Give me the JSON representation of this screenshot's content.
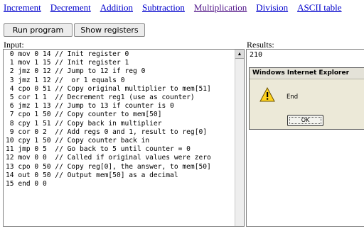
{
  "nav": {
    "links": [
      "Increment",
      "Decrement",
      "Addition",
      "Subtraction",
      "Multiplication",
      "Division",
      "ASCII table"
    ]
  },
  "buttons": {
    "run": "Run program",
    "show": "Show registers"
  },
  "input": {
    "label": "Input:",
    "lines": [
      " 0 mov 0 14 // Init register 0",
      " 1 mov 1 15 // Init register 1",
      " 2 jmz 0 12 // Jump to 12 if reg 0",
      " 3 jmz 1 12 //  or 1 equals 0",
      " 4 cpo 0 51 // Copy original multiplier to mem[51]",
      " 5 cor 1 1  // Decrement reg1 (use as counter)",
      " 6 jmz 1 13 // Jump to 13 if counter is 0",
      " 7 cpo 1 50 // Copy counter to mem[50]",
      " 8 cpy 1 51 // Copy back in multiplier",
      " 9 cor 0 2  // Add regs 0 and 1, result to reg[0]",
      "10 cpy 1 50 // Copy counter back in",
      "11 jmp 0 5  // Go back to 5 until counter = 0",
      "12 mov 0 0  // Called if original values were zero",
      "13 cpo 0 50 // Copy reg[0], the answer, to mem[50]",
      "14 out 0 50 // Output mem[50] as a decimal",
      "15 end 0 0"
    ]
  },
  "results": {
    "label": "Results:",
    "value": "210"
  },
  "dialog": {
    "title": "Windows Internet Explorer",
    "message": "End",
    "ok": "OK"
  }
}
